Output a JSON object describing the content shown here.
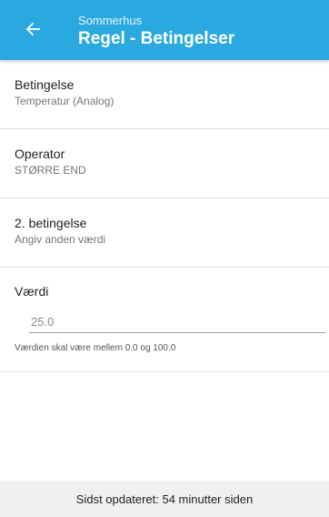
{
  "appbar": {
    "subtitle": "Sommerhus",
    "title": "Regel - Betingelser",
    "back_icon": "arrow-left-icon",
    "color": "#29a9e0"
  },
  "rows": [
    {
      "label": "Betingelse",
      "value": "Temperatur (Analog)"
    },
    {
      "label": "Operator",
      "value": "STØRRE END"
    },
    {
      "label": "2. betingelse",
      "value": "Angiv anden værdi"
    }
  ],
  "value_field": {
    "label": "Værdi",
    "value": "25.0",
    "hint": "Værdien skal være mellem 0.0 og 100.0"
  },
  "footer": {
    "text": "Sidst opdateret: 54 minutter siden"
  }
}
